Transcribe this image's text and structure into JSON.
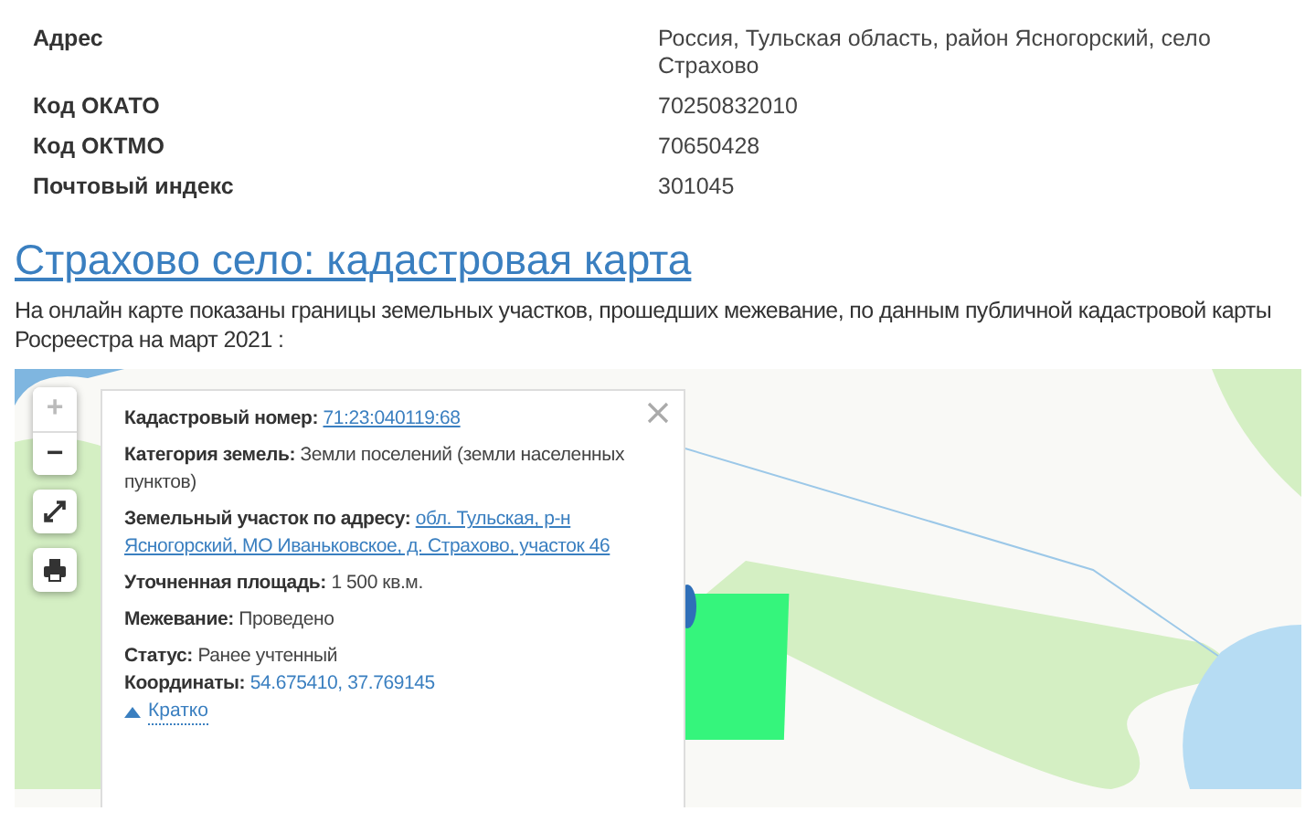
{
  "info": [
    {
      "label": "Адрес",
      "value": "Россия, Тульская область, район Ясногорский, село Страхово"
    },
    {
      "label": "Код ОКАТО",
      "value": "70250832010"
    },
    {
      "label": "Код ОКТМО",
      "value": "70650428"
    },
    {
      "label": "Почтовый индекс",
      "value": "301045"
    }
  ],
  "heading": "Страхово село: кадастровая карта",
  "description": "На онлайн карте показаны границы земельных участков, прошедших межевание, по данным публичной кадастровой карты Росреестра на март 2021 :",
  "map": {
    "zoom_in": {
      "label": "+",
      "disabled": true
    },
    "zoom_out": {
      "label": "−",
      "disabled": false
    },
    "popup": {
      "sections": [
        [
          {
            "label": "Кадастровый номер:",
            "value": "71:23:040119:68",
            "kind": "link"
          }
        ],
        [
          {
            "label": "Категория земель:",
            "value": "Земли поселений (земли населенных пунктов)",
            "kind": "text"
          }
        ],
        [
          {
            "label": "Земельный участок по адресу:",
            "value": "обл. Тульская, р-н Ясногорский, МО Иваньковское, д. Страхово, участок 46",
            "kind": "link"
          }
        ],
        [
          {
            "label": "Уточненная площадь:",
            "value": "1 500 кв.м.",
            "kind": "text"
          }
        ],
        [
          {
            "label": "Межевание:",
            "value": "Проведено",
            "kind": "text"
          }
        ],
        [
          {
            "label": "Статус:",
            "value": "Ранее учтенный",
            "kind": "text"
          },
          {
            "label": "Координаты:",
            "value": "54.675410, 37.769145",
            "kind": "coords"
          }
        ]
      ],
      "toggle": "Кратко"
    }
  }
}
